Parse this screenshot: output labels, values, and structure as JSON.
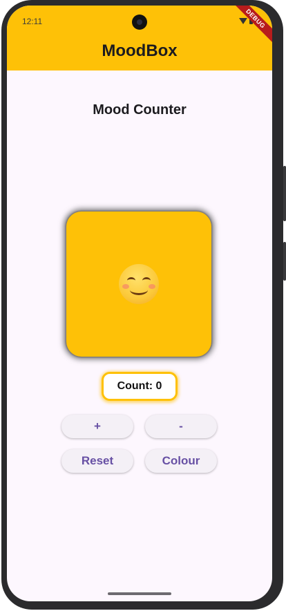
{
  "status_bar": {
    "time": "12:11",
    "icons": [
      "wifi-icon",
      "battery-icon"
    ]
  },
  "debug_banner": "DEBUG",
  "app_bar": {
    "title": "MoodBox",
    "color": "#fec107"
  },
  "main": {
    "heading": "Mood Counter",
    "mood": {
      "icon": "smiling-face-icon",
      "emoji": "😊",
      "box_color": "#fec107"
    },
    "count_label": "Count: 0",
    "buttons": {
      "increment_label": "+",
      "decrement_label": "-",
      "reset_label": "Reset",
      "colour_label": "Colour"
    },
    "button_text_color": "#6750a4"
  }
}
